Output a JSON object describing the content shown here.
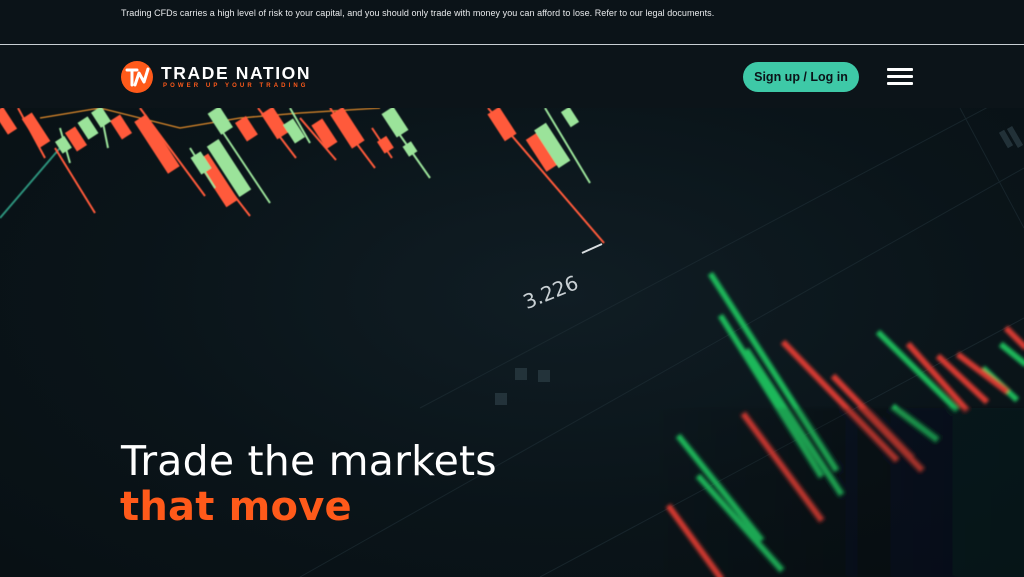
{
  "risk_warning": "Trading CFDs carries a high level of risk to your capital, and you should only trade with money you can afford to lose. Refer to our legal documents.",
  "header": {
    "brand_name": "TRADE NATION",
    "brand_tagline": "POWER UP YOUR TRADING",
    "signup_label": "Sign up / Log in",
    "menu_icon": "hamburger-menu-icon"
  },
  "hero": {
    "headline_line1": "Trade the markets",
    "headline_line2": "that move",
    "price_readout": "3.226"
  },
  "colors": {
    "accent_orange": "#ff5a1a",
    "accent_teal": "#3ec9a7",
    "candle_up": "#9be39a",
    "candle_down": "#ff5a3a",
    "background": "#0b1318"
  }
}
